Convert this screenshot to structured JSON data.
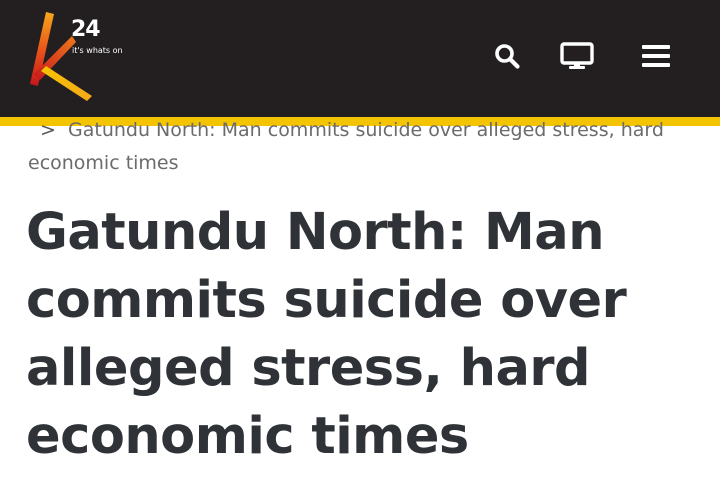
{
  "header": {
    "logo": {
      "number": "24",
      "tagline": "it's whats on",
      "colors": {
        "k_gradient_start": "#e3261b",
        "k_gradient_end": "#f5c400"
      }
    },
    "icons": [
      "search-icon",
      "tv-icon",
      "hamburger-menu-icon"
    ],
    "background_color": "#231f20",
    "stripe_color": "#f5c400"
  },
  "breadcrumb": {
    "separator": ">",
    "current": "Gatundu North: Man commits suicide over alleged stress, hard economic times"
  },
  "article": {
    "title": "Gatundu North: Man commits suicide over alleged stress, hard economic times"
  }
}
